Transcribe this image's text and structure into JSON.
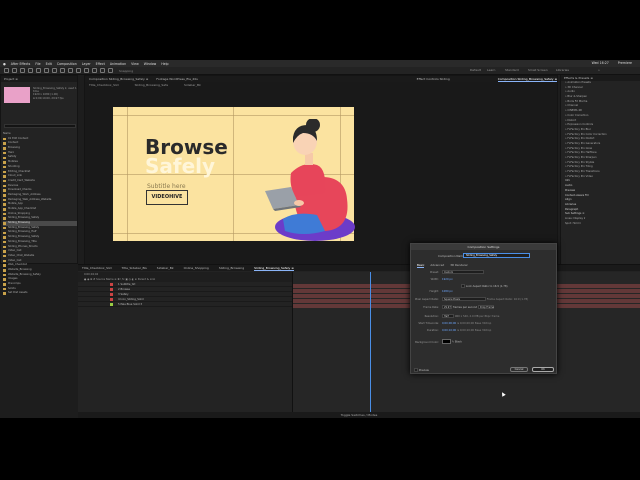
{
  "menu": [
    "After Effects",
    "File",
    "Edit",
    "Composition",
    "Layer",
    "Effect",
    "Animation",
    "View",
    "Window",
    "Help"
  ],
  "menubar": {
    "clock": "Wed 16:27",
    "user": "Premiere"
  },
  "toolbar": {
    "snapping": "Snapping",
    "ws": [
      "Default",
      "Learn",
      "Standard",
      "Small Screen",
      "Libraries",
      "»"
    ]
  },
  "project": {
    "tab": "Project  ≡",
    "meta": [
      "Sliding_Browsing_Safely ▾, used 1 time",
      "1920 x 1080 (1.00)",
      "Δ 0;00;10;00, 29.97 fps"
    ],
    "items": [
      {
        "label": "Name",
        "folder": false,
        "sel": false
      },
      {
        "label": "01 Edit Content",
        "folder": true,
        "sel": false
      },
      {
        "label": "Content",
        "folder": true,
        "sel": false
      },
      {
        "label": "Browsing",
        "folder": true,
        "sel": false
      },
      {
        "label": "Hero",
        "folder": true,
        "sel": false
      },
      {
        "label": "Safety",
        "folder": true,
        "sel": false
      },
      {
        "label": "Mobiles",
        "folder": true,
        "sel": false
      },
      {
        "label": "Shooting",
        "folder": true,
        "sel": false
      },
      {
        "label": "Editing_Checklist",
        "folder": true,
        "sel": false
      },
      {
        "label": "Cloud_Link",
        "folder": true,
        "sel": false
      },
      {
        "label": "Credit_Card_Website",
        "folder": true,
        "sel": false
      },
      {
        "label": "Devices",
        "folder": true,
        "sel": false
      },
      {
        "label": "Download_Checks",
        "folder": true,
        "sel": false
      },
      {
        "label": "Packaging_Work_Address",
        "folder": true,
        "sel": false
      },
      {
        "label": "Packaging_Web_Address_Website",
        "folder": true,
        "sel": false
      },
      {
        "label": "Mobile_App",
        "folder": true,
        "sel": false
      },
      {
        "label": "Mobile_App_Checklist",
        "folder": true,
        "sel": false
      },
      {
        "label": "Online_Shopping",
        "folder": true,
        "sel": false
      },
      {
        "label": "Sliding_Browsing_Safely",
        "folder": true,
        "sel": false
      },
      {
        "label": "Sliding_Browsing",
        "folder": true,
        "sel": true
      },
      {
        "label": "Sliding_Browsing_Safely",
        "folder": true,
        "sel": false
      },
      {
        "label": "Sliding_Browsing_Half",
        "folder": true,
        "sel": false
      },
      {
        "label": "Sliding_Browsing_Safely",
        "folder": true,
        "sel": false
      },
      {
        "label": "Sliding_Browsing_Title",
        "folder": true,
        "sel": false
      },
      {
        "label": "Sliding_Phones_Shoots",
        "folder": true,
        "sel": false
      },
      {
        "label": "Video_Call",
        "folder": true,
        "sel": false
      },
      {
        "label": "Video_Chat_Website",
        "folder": true,
        "sel": false
      },
      {
        "label": "Video_Call",
        "folder": true,
        "sel": false
      },
      {
        "label": "Web_Checklist",
        "folder": true,
        "sel": false
      },
      {
        "label": "Website_Browsing",
        "folder": true,
        "sel": false
      },
      {
        "label": "Website_Browsing_Safely",
        "folder": true,
        "sel": false
      },
      {
        "label": "Images",
        "folder": true,
        "sel": false
      },
      {
        "label": "Precomps",
        "folder": true,
        "sel": false
      },
      {
        "label": "Solids",
        "folder": true,
        "sel": false
      },
      {
        "label": "Set Dist Assets",
        "folder": true,
        "sel": false
      }
    ]
  },
  "viewer": {
    "tabs": [
      "Composition  Sliding_Browsing_Safely ≡",
      "Footage  WordPress_file_20s",
      "Effect Controls  Sliding",
      "Composition  Sliding_Browsing_Safely ≡"
    ],
    "subtabs": [
      "Title_Checkbox_Slid",
      "Sliding_Browsing_Safe",
      "Sidebar_Bk"
    ],
    "footer": "100%   ▾   ⊞   0;00;04;04   ◎  ♣   Full   ▾   Active Camera   ▾   1 View   ▾   ⊞  ⊡  ⊞  +0.0"
  },
  "canvas": {
    "line1": "Browse",
    "line2": "Safely",
    "subtitle": "Subtitle here",
    "logo": "VIDEOHIVE"
  },
  "effects": {
    "tab": "Effects & Presets  ≡",
    "items": [
      {
        "t": "» Animation Presets",
        "h": false
      },
      {
        "t": "» 3D Channel",
        "h": false
      },
      {
        "t": "» Audio",
        "h": false
      },
      {
        "t": "» Blur & Sharpen",
        "h": false
      },
      {
        "t": "» Boris FX Mocha",
        "h": false
      },
      {
        "t": "» Channel",
        "h": false
      },
      {
        "t": "» CINEMA 4D",
        "h": false
      },
      {
        "t": "» Color Correction",
        "h": false
      },
      {
        "t": "» Distort",
        "h": false
      },
      {
        "t": "» Expression Controls",
        "h": false
      },
      {
        "t": "» FxFactory Pro Blur",
        "h": false
      },
      {
        "t": "» FxFactory Pro Color Correction",
        "h": false
      },
      {
        "t": "» FxFactory Pro Distort",
        "h": false
      },
      {
        "t": "» FxFactory Pro Generators",
        "h": false
      },
      {
        "t": "» FxFactory Pro Glow",
        "h": false
      },
      {
        "t": "» FxFactory Pro Halftone",
        "h": false
      },
      {
        "t": "» FxFactory Pro Sharpen",
        "h": false
      },
      {
        "t": "» FxFactory Pro Stylize",
        "h": false
      },
      {
        "t": "» FxFactory Pro Tiling",
        "h": false
      },
      {
        "t": "» FxFactory Pro Transitions",
        "h": false
      },
      {
        "t": "» FxFactory Pro Video",
        "h": false
      },
      {
        "t": "Info",
        "h": true
      },
      {
        "t": "Audio",
        "h": true
      },
      {
        "t": "Preview",
        "h": true
      },
      {
        "t": "Content-Aware Fill",
        "h": true
      },
      {
        "t": "Align",
        "h": true
      },
      {
        "t": "Libraries",
        "h": true
      },
      {
        "t": "Paragraph",
        "h": true
      },
      {
        "t": "Sub Settings  ≡",
        "h": true
      },
      {
        "t": "Lines: Display  ▾",
        "h": false
      },
      {
        "t": "Spot:  Hold  ▾",
        "h": false
      }
    ]
  },
  "timeline": {
    "tabs": [
      "Title_Checkbox_Slid",
      "Title_Sidebar_BG",
      "Sidebar_Bk",
      "Online_Shopping",
      "Sliding_Browsing",
      "Sliding_Browsing_Safely ≡"
    ],
    "timecode": "0;00;04;04",
    "column_header": "●  ◉  ⊞  #   Source Name              ⊕  ✱  \\ fx ▣ ◎ ◐ ⊕   Parent & Link",
    "layers": [
      {
        "n": "1",
        "name": "Subtitle_txt",
        "color": "#c44"
      },
      {
        "n": "2",
        "name": "Browse",
        "color": "#c44"
      },
      {
        "n": "3",
        "name": "Safely",
        "color": "#c44"
      },
      {
        "n": "4",
        "name": "Icon_Sliding_Solid",
        "color": "#c44"
      },
      {
        "n": "5",
        "name": "Pale Blue Solid 3",
        "color": "#9c4"
      }
    ],
    "status": "Toggle Switches / Modes"
  },
  "dialog": {
    "title": "Composition Settings",
    "name_label": "Composition Name:",
    "name_value": "Sliding_Browsing_Safely",
    "tabs": [
      "Basic",
      "Advanced",
      "3D Renderer"
    ],
    "preset": {
      "label": "Preset:",
      "value": "Custom"
    },
    "width": {
      "label": "Width:",
      "value": "1920 px"
    },
    "lock_aspect": "Lock Aspect Ratio to 16:9 (1.78)",
    "height": {
      "label": "Height:",
      "value": "1080 px"
    },
    "pixel_aspect": {
      "label": "Pixel Aspect Ratio:",
      "value": "Square Pixels"
    },
    "frame_aspect": "Frame Aspect Ratio: 16:9 (1.78)",
    "frame_rate": {
      "label": "Frame Rate:",
      "value": "29.97",
      "unit": "frames per second",
      "drop": "Drop Frame"
    },
    "resolution": {
      "label": "Resolution:",
      "value": "Half",
      "info": "960 x 540, 2.0 MB per 8bpc frame"
    },
    "start_tc": {
      "label": "Start Timecode:",
      "value": "0;00;00;00",
      "info": "is 0;00;00;00  Base 30drop"
    },
    "duration": {
      "label": "Duration:",
      "value": "0;00;10;00",
      "info": "is 0;00;10;00  Base 30drop"
    },
    "bg": {
      "label": "Background Color:",
      "value": "Black"
    },
    "preview": "Preview",
    "cancel": "Cancel",
    "ok": "OK"
  }
}
